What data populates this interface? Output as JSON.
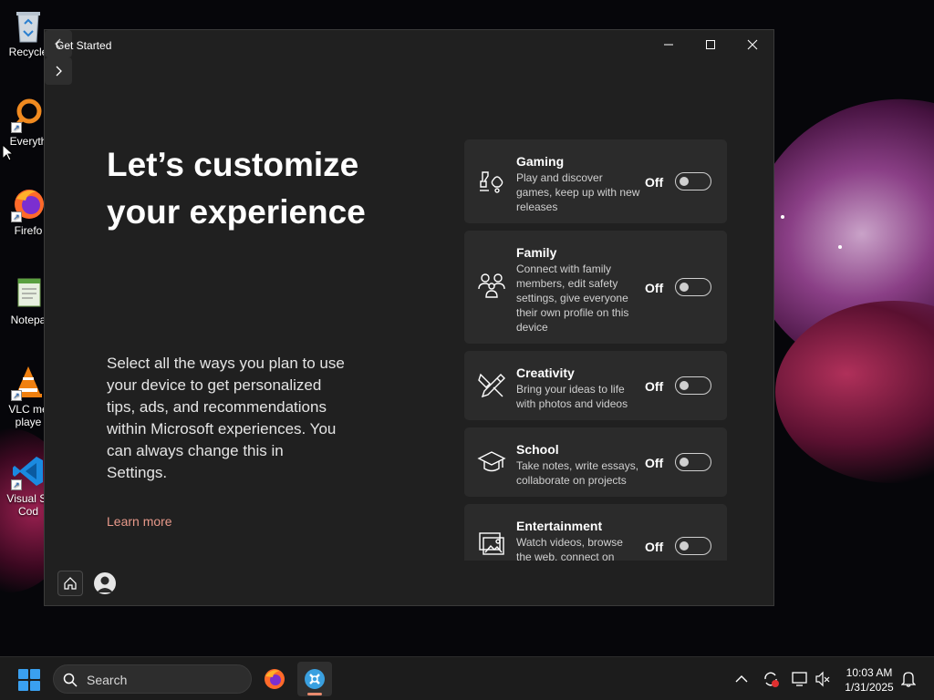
{
  "desktop": {
    "icons": [
      {
        "label": "Recycle",
        "icon": "recycle-bin-icon"
      },
      {
        "label": "Everyth",
        "icon": "everything-search-icon"
      },
      {
        "label": "Firefo",
        "icon": "firefox-icon"
      },
      {
        "label": "Notepa",
        "icon": "notepad-icon"
      },
      {
        "label": "VLC me",
        "label2": "playe",
        "icon": "vlc-icon"
      },
      {
        "label": "Visual St",
        "label2": "Cod",
        "icon": "vscode-icon"
      }
    ]
  },
  "window": {
    "title": "Get Started",
    "heading": "Let’s customize your experience",
    "description": "Select all the ways you plan to use your device to get personalized tips, ads, and recommendations within Microsoft experiences. You can always change this in Settings.",
    "learn_more": "Learn more",
    "cards": [
      {
        "title": "Gaming",
        "subtitle": "Play and discover games, keep up with new releases",
        "state": "Off",
        "icon": "gaming-icon"
      },
      {
        "title": "Family",
        "subtitle": "Connect with family members, edit safety settings, give everyone their own profile on this device",
        "state": "Off",
        "icon": "family-icon"
      },
      {
        "title": "Creativity",
        "subtitle": "Bring your ideas to life with photos and videos",
        "state": "Off",
        "icon": "creativity-icon"
      },
      {
        "title": "School",
        "subtitle": "Take notes, write essays, collaborate on projects",
        "state": "Off",
        "icon": "school-icon"
      },
      {
        "title": "Entertainment",
        "subtitle": "Watch videos, browse the web, connect on",
        "state": "Off",
        "icon": "entertainment-icon"
      }
    ]
  },
  "taskbar": {
    "search_label": "Search",
    "time": "10:03 AM",
    "date": "1/31/2025"
  },
  "colors": {
    "window_bg": "#202020",
    "card_bg": "#2b2b2b",
    "link": "#e8998a",
    "accent": "#3aa0f0"
  }
}
